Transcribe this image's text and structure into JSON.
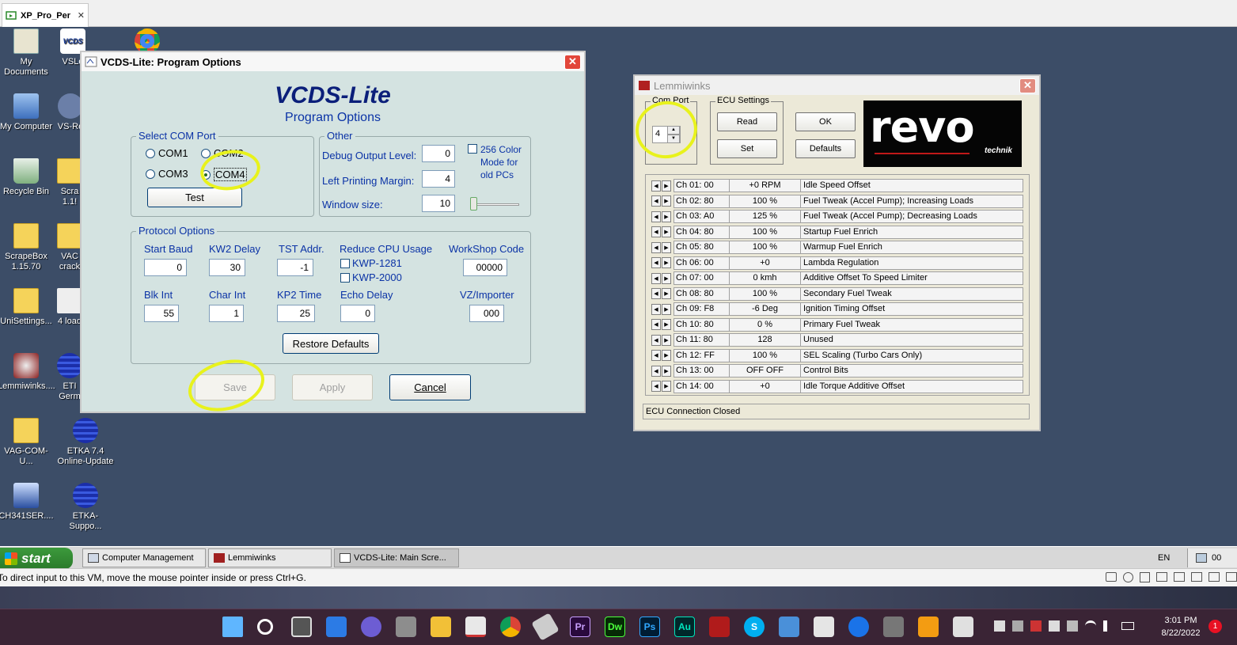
{
  "host": {
    "tab_title": "XP_Pro_Per",
    "close_glyph": "✕",
    "vm_status": "To direct input to this VM, move the mouse pointer inside or press Ctrl+G."
  },
  "desktop_icons": [
    {
      "label": "My Documents",
      "icon": "documents-icon"
    },
    {
      "label": "VSLo",
      "icon": "vcds-icon"
    },
    {
      "label": "My Computer",
      "icon": "computer-icon"
    },
    {
      "label": "VS-Re",
      "icon": "app-icon"
    },
    {
      "label": "Recycle Bin",
      "icon": "recycle-bin-icon"
    },
    {
      "label": "Scra 1.1!",
      "icon": "folder-icon"
    },
    {
      "label": "ScrapeBox 1.15.70",
      "icon": "folder-icon"
    },
    {
      "label": "VAC crack",
      "icon": "folder-icon"
    },
    {
      "label": "UniSettings...",
      "icon": "folder-icon"
    },
    {
      "label": "4 load",
      "icon": "app-icon"
    },
    {
      "label": "Lemmiwinks....",
      "icon": "lemmiwinks-icon"
    },
    {
      "label": "ETI Germ",
      "icon": "etka-icon"
    },
    {
      "label": "VAG-COM-U...",
      "icon": "folder-icon"
    },
    {
      "label": "ETKA 7.4 Online-Update",
      "icon": "etka-icon"
    },
    {
      "label": "CH341SER....",
      "icon": "installer-icon"
    },
    {
      "label": "ETKA-Suppo...",
      "icon": "etka-icon"
    }
  ],
  "vcds": {
    "window_title": "VCDS-Lite: Program Options",
    "heading": "VCDS-Lite",
    "subheading": "Program Options",
    "com_port": {
      "legend": "Select COM Port",
      "options": [
        "COM1",
        "COM2",
        "COM3",
        "COM4"
      ],
      "selected": "COM4",
      "test_label": "Test"
    },
    "other": {
      "legend": "Other",
      "debug_label": "Debug Output Level:",
      "debug_value": "0",
      "margin_label": "Left Printing Margin:",
      "margin_value": "4",
      "window_label": "Window size:",
      "window_value": "10",
      "color_mode_line1": "256 Color",
      "color_mode_line2": "Mode for",
      "color_mode_line3": "old PCs"
    },
    "protocol": {
      "legend": "Protocol Options",
      "start_baud_label": "Start Baud",
      "start_baud_value": "0",
      "kw2_delay_label": "KW2 Delay",
      "kw2_delay_value": "30",
      "tst_addr_label": "TST Addr.",
      "tst_addr_value": "-1",
      "reduce_cpu_label": "Reduce CPU Usage",
      "kwp1281_label": "KWP-1281",
      "kwp2000_label": "KWP-2000",
      "workshop_label": "WorkShop Code",
      "workshop_value": "00000",
      "blk_int_label": "Blk Int",
      "blk_int_value": "55",
      "char_int_label": "Char Int",
      "char_int_value": "1",
      "kp2_time_label": "KP2 Time",
      "kp2_time_value": "25",
      "echo_delay_label": "Echo Delay",
      "echo_delay_value": "0",
      "vz_label": "VZ/Importer",
      "vz_value": "000",
      "restore_label": "Restore Defaults"
    },
    "save_label": "Save",
    "apply_label": "Apply",
    "cancel_label": "Cancel"
  },
  "lemmiwinks": {
    "window_title": "Lemmiwinks",
    "com_port_label": "Com Port",
    "com_port_value": "4",
    "ecu_settings_label": "ECU Settings",
    "read_label": "Read",
    "set_label": "Set",
    "ok_label": "OK",
    "defaults_label": "Defaults",
    "logo_text": "revo",
    "logo_sub": "technik",
    "status": "ECU Connection Closed",
    "channels": [
      {
        "ch": "Ch 01: 00",
        "val": "+0 RPM",
        "desc": "Idle Speed Offset"
      },
      {
        "ch": "Ch 02: 80",
        "val": "100 %",
        "desc": "Fuel Tweak (Accel Pump); Increasing Loads"
      },
      {
        "ch": "Ch 03: A0",
        "val": "125 %",
        "desc": "Fuel Tweak (Accel Pump); Decreasing Loads"
      },
      {
        "ch": "Ch 04: 80",
        "val": "100 %",
        "desc": "Startup Fuel Enrich"
      },
      {
        "ch": "Ch 05: 80",
        "val": "100 %",
        "desc": "Warmup Fuel Enrich"
      },
      {
        "ch": "Ch 06: 00",
        "val": "+0",
        "desc": "Lambda Regulation"
      },
      {
        "ch": "Ch 07: 00",
        "val": "0 kmh",
        "desc": "Additive Offset To Speed Limiter"
      },
      {
        "ch": "Ch 08: 80",
        "val": "100 %",
        "desc": "Secondary Fuel Tweak"
      },
      {
        "ch": "Ch 09: F8",
        "val": "-6 Deg",
        "desc": "Ignition Timing Offset"
      },
      {
        "ch": "Ch 10: 80",
        "val": "0 %",
        "desc": "Primary Fuel Tweak"
      },
      {
        "ch": "Ch 11: 80",
        "val": "128",
        "desc": "Unused"
      },
      {
        "ch": "Ch 12: FF",
        "val": "100 %",
        "desc": "SEL Scaling (Turbo Cars Only)"
      },
      {
        "ch": "Ch 13: 00",
        "val": "OFF  OFF",
        "desc": "Control Bits"
      },
      {
        "ch": "Ch 14: 00",
        "val": "+0",
        "desc": "Idle Torque Additive Offset"
      }
    ]
  },
  "xp_taskbar": {
    "start_label": "start",
    "tasks": [
      "Computer Management",
      "Lemmiwinks",
      "VCDS-Lite: Main Scre..."
    ],
    "lang": "EN",
    "tray_time": "00"
  },
  "win11": {
    "time": "3:01 PM",
    "date": "8/22/2022",
    "notification_count": "1",
    "app_labels": {
      "premiere": "Pr",
      "dreamweaver": "Dw",
      "photoshop": "Ps",
      "audition": "Au",
      "skype": "S"
    }
  }
}
